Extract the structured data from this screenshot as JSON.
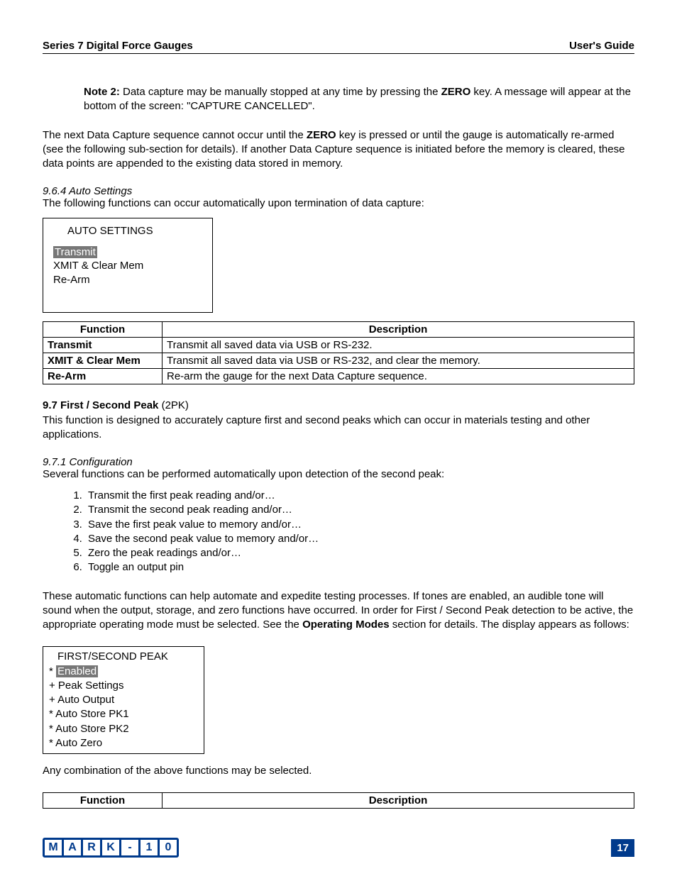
{
  "header": {
    "left": "Series 7 Digital Force Gauges",
    "right": "User's Guide"
  },
  "note2": {
    "label": "Note 2:",
    "text": " Data capture may be manually stopped at any time by pressing the ",
    "key": "ZERO",
    "text2": " key. A message will appear at the bottom of the screen: \"CAPTURE CANCELLED\"."
  },
  "p1a": "The next Data Capture sequence cannot occur until the ",
  "p1key": "ZERO",
  "p1b": " key is pressed or until the gauge is automatically re-armed (see the following sub-section for details). If another Data Capture sequence is initiated before the memory is cleared, these data points are appended to the existing data stored in memory.",
  "sec964": "9.6.4 Auto Settings",
  "sec964text": "The following functions can occur automatically upon termination of data capture:",
  "box1": {
    "title": "AUTO SETTINGS",
    "i1": "Transmit",
    "i2": "XMIT & Clear Mem",
    "i3": "Re-Arm"
  },
  "tableHeaders": {
    "f": "Function",
    "d": "Description"
  },
  "table1": [
    {
      "f": "Transmit",
      "d": "Transmit all saved data via USB or RS-232."
    },
    {
      "f": "XMIT & Clear Mem",
      "d": "Transmit all saved data via USB or RS-232, and clear the memory."
    },
    {
      "f": "Re-Arm",
      "d": "Re-arm the gauge for the next Data Capture sequence."
    }
  ],
  "sec97bold": "9.7 First / Second Peak",
  "sec97paren": " (2PK)",
  "sec97text": "This function is designed to accurately capture first and second peaks which can occur in materials testing and other applications.",
  "sec971": "9.7.1 Configuration",
  "sec971text": "Several functions can be performed automatically upon detection of the second peak:",
  "list": [
    "Transmit the first peak reading and/or…",
    "Transmit the second peak reading and/or…",
    "Save the first peak value to memory and/or…",
    "Save the second peak value to memory and/or…",
    "Zero the peak readings and/or…",
    "Toggle an output pin"
  ],
  "p2a": "These automatic functions can help automate and expedite testing processes. If tones are enabled, an audible tone will sound when the output, storage, and zero functions have occurred.  In order for First / Second Peak detection to be active, the appropriate operating mode must be selected. See the ",
  "p2bold": "Operating Modes",
  "p2b": " section for details. The display appears as follows:",
  "box2": {
    "title": "FIRST/SECOND PEAK",
    "i1p": "*  ",
    "i1": "Enabled",
    "i2": "+ Peak Settings",
    "i3": "+ Auto Output",
    "i4": "*  Auto Store PK1",
    "i5": "*  Auto Store PK2",
    "i6": "*  Auto Zero"
  },
  "p3": "Any combination of the above functions may be selected.",
  "logo": [
    "M",
    "A",
    "R",
    "K",
    "-",
    "1",
    "0"
  ],
  "pageNum": "17"
}
